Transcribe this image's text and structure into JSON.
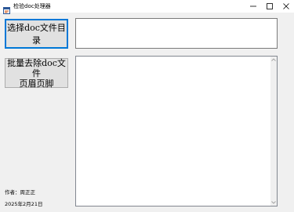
{
  "window": {
    "title": "检验doc处理器",
    "icon": "app-window-icon"
  },
  "buttons": {
    "select_dir": "选择doc文件目录",
    "batch_remove_line1": "批量去除doc文件",
    "batch_remove_line2": "页眉页脚"
  },
  "path_input": {
    "value": ""
  },
  "log": {
    "value": ""
  },
  "footer": {
    "author": "作者：周正正",
    "date": "2025年2月21日"
  }
}
